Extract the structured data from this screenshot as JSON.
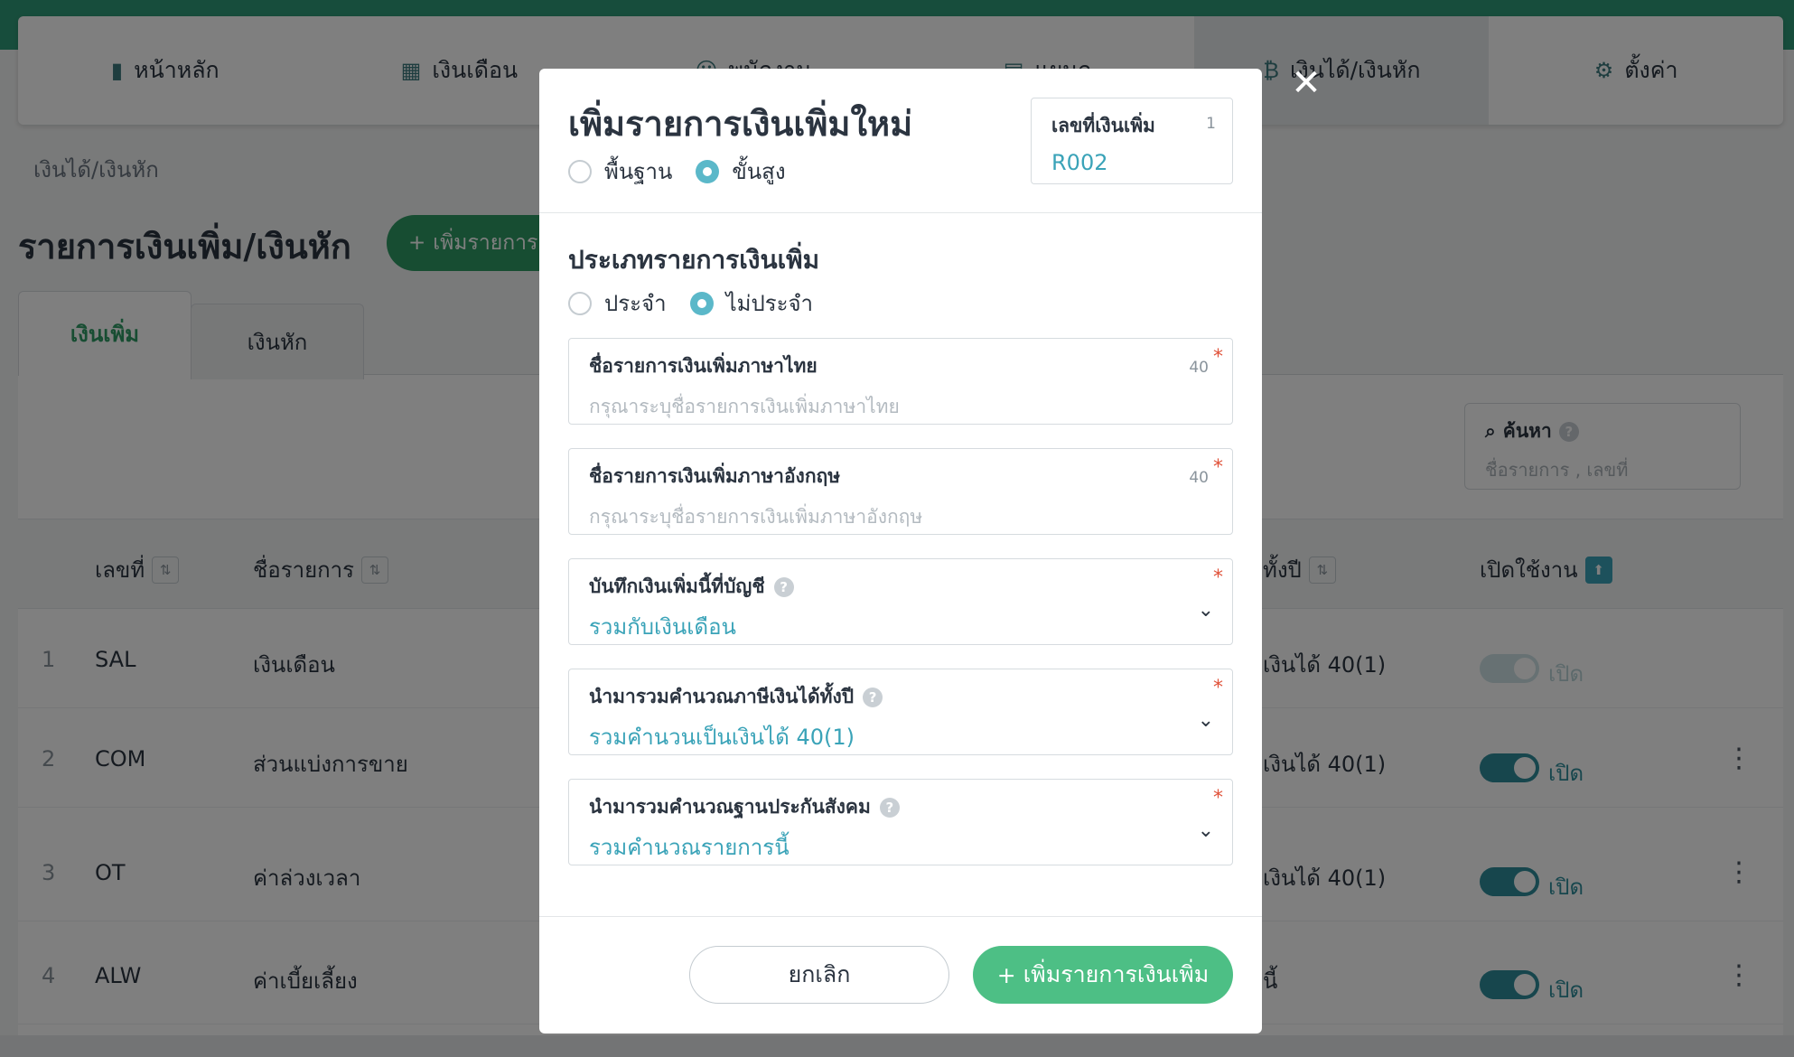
{
  "nav": [
    {
      "icon": "bar-chart-icon",
      "glyph": "▮",
      "label": "หน้าหลัก"
    },
    {
      "icon": "calendar-icon",
      "glyph": "▦",
      "label": "เงินเดือน"
    },
    {
      "icon": "people-icon",
      "glyph": "☺",
      "label": "พนักงาน"
    },
    {
      "icon": "department-icon",
      "glyph": "▤",
      "label": "แผนก"
    },
    {
      "icon": "money-icon",
      "glyph": "₿",
      "label": "เงินได้/เงินหัก"
    },
    {
      "icon": "gears-icon",
      "glyph": "⚙",
      "label": "ตั้งค่า"
    }
  ],
  "breadcrumb": "เงินได้/เงินหัก",
  "page_title": "รายการเงินเพิ่ม/เงินหัก",
  "add_item_button": "เพิ่มรายการ",
  "tabs": {
    "income": "เงินเพิ่ม",
    "deduction": "เงินหัก"
  },
  "search": {
    "label": "ค้นหา",
    "placeholder": "ชื่อรายการ , เลขที่"
  },
  "table": {
    "headers": {
      "number": "เลขที่",
      "name": "ชื่อรายการ",
      "tax": "ทั้งปี",
      "enabled": "เปิดใช้งาน"
    },
    "rows": [
      {
        "index": "1",
        "code": "SAL",
        "name": "เงินเดือน",
        "tax": "เงินได้ 40(1)",
        "status": "เปิด"
      },
      {
        "index": "2",
        "code": "COM",
        "name": "ส่วนแบ่งการขาย",
        "tax": "เงินได้ 40(1)",
        "status": "เปิด"
      },
      {
        "index": "3",
        "code": "OT",
        "name": "ค่าล่วงเวลา",
        "tax": "เงินได้ 40(1)",
        "status": "เปิด"
      },
      {
        "index": "4",
        "code": "ALW",
        "name": "ค่าเบี้ยเลี้ยง",
        "tax": "นี้",
        "status": "เปิด"
      }
    ]
  },
  "modal": {
    "title": "เพิ่มรายการเงินเพิ่มใหม่",
    "mode_options": [
      "พื้นฐาน",
      "ขั้นสูง"
    ],
    "mode_selected": "ขั้นสูง",
    "doc_number": {
      "label": "เลขที่เงินเพิ่ม",
      "count": "1",
      "value": "R002"
    },
    "type_title": "ประเภทรายการเงินเพิ่ม",
    "type_options": [
      "ประจำ",
      "ไม่ประจำ"
    ],
    "type_selected": "ไม่ประจำ",
    "fields": {
      "name_th": {
        "label": "ชื่อรายการเงินเพิ่มภาษาไทย",
        "placeholder": "กรุณาระบุชื่อรายการเงินเพิ่มภาษาไทย",
        "max": "40"
      },
      "name_en": {
        "label": "ชื่อรายการเงินเพิ่มภาษาอังกฤษ",
        "placeholder": "กรุณาระบุชื่อรายการเงินเพิ่มภาษาอังกฤษ",
        "max": "40"
      },
      "account": {
        "label": "บันทึกเงินเพิ่มนี้ที่บัญชี",
        "value": "รวมกับเงินเดือน"
      },
      "tax": {
        "label": "นำมารวมคำนวณภาษีเงินได้ทั้งปี",
        "value": "รวมคำนวนเป็นเงินได้ 40(1)"
      },
      "sso": {
        "label": "นำมารวมคำนวณฐานประกันสังคม",
        "value": "รวมคำนวณรายการนี้"
      }
    },
    "required_mark": "*",
    "cancel_label": "ยกเลิก",
    "submit_label": "เพิ่มรายการเงินเพิ่ม"
  }
}
